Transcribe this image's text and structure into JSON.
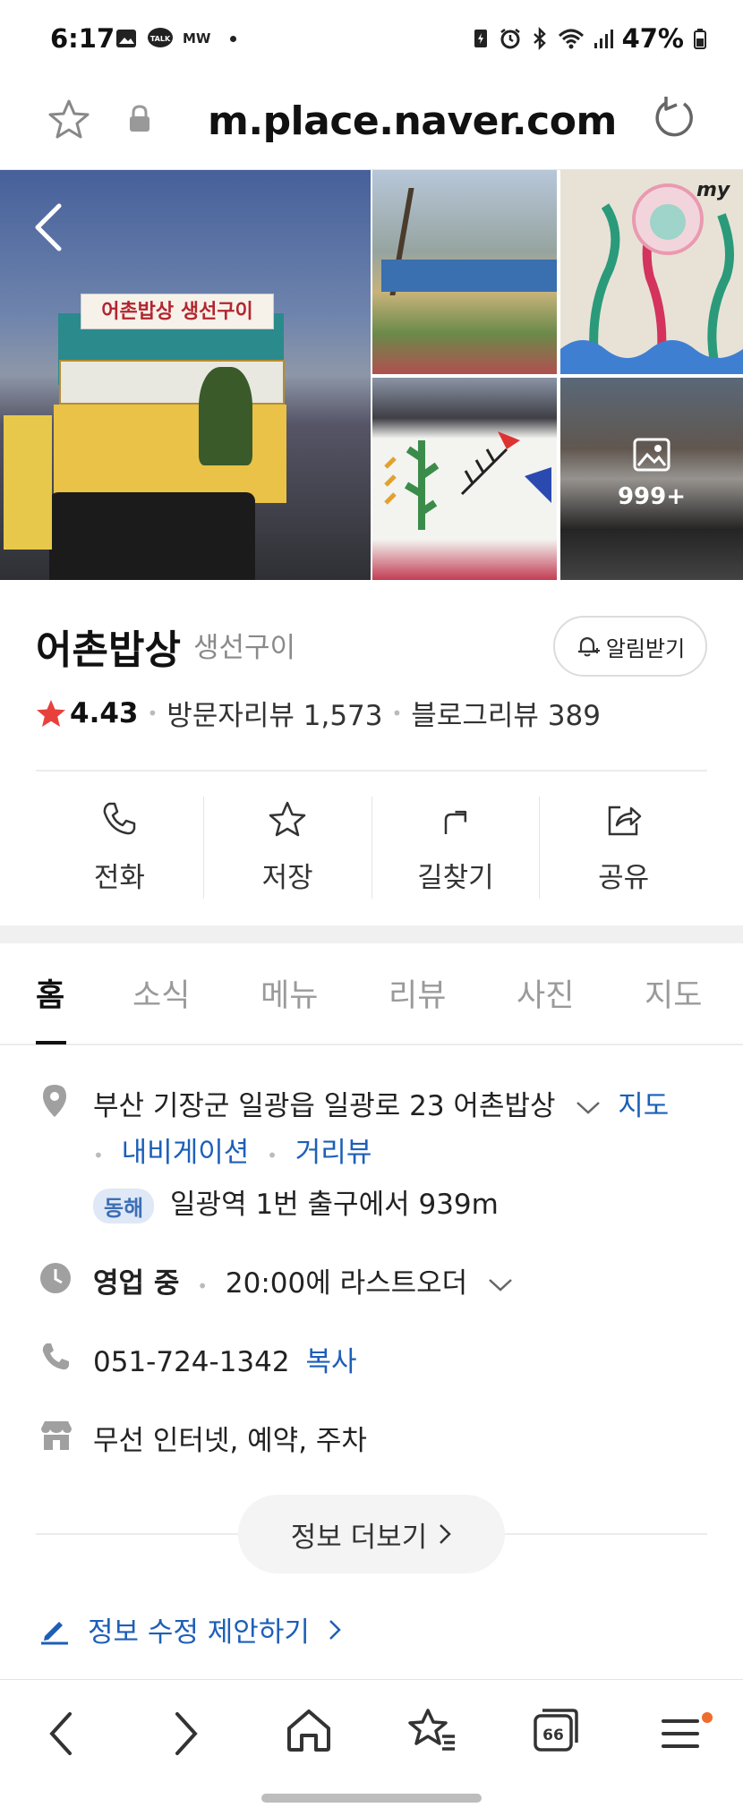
{
  "status_bar": {
    "time": "6:17",
    "left_extra": "MW",
    "battery_pct": "47%"
  },
  "browser": {
    "url": "m.place.naver.com"
  },
  "gallery": {
    "sign_text": "어촌밥상 생선구이",
    "photo_count": "999+"
  },
  "place": {
    "name": "어촌밥상",
    "category": "생선구이",
    "notify_label": "알림받기",
    "rating": "4.43",
    "visitor_reviews": "방문자리뷰 1,573",
    "blog_reviews": "블로그리뷰 389"
  },
  "actions": [
    {
      "label": "전화",
      "icon": "phone-icon"
    },
    {
      "label": "저장",
      "icon": "star-icon"
    },
    {
      "label": "길찾기",
      "icon": "directions-icon"
    },
    {
      "label": "공유",
      "icon": "share-icon"
    }
  ],
  "tabs": [
    "홈",
    "소식",
    "메뉴",
    "리뷰",
    "사진",
    "지도"
  ],
  "active_tab": "홈",
  "info": {
    "address": "부산 기장군 일광읍 일광로 23 어촌밥상",
    "map_link": "지도",
    "navigation_link": "내비게이션",
    "streetview_link": "거리뷰",
    "subway_line": "동해",
    "subway_text": "일광역 1번 출구에서 939m",
    "hours_status": "영업 중",
    "hours_detail": "20:00에 라스트오더",
    "phone": "051-724-1342",
    "copy_link": "복사",
    "amenities": "무선 인터넷, 예약, 주차"
  },
  "more_button": "정보 더보기",
  "edit_suggest": "정보 수정 제안하기",
  "colors": {
    "link_blue": "#1d5fb8",
    "star_red": "#e8413c",
    "badge_bg": "#dfe8f6",
    "notify_dot": "#ef6c2c"
  }
}
